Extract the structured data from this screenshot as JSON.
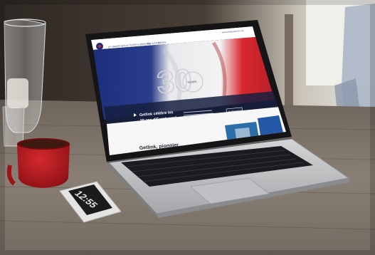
{
  "site": {
    "nav": {
      "items": [
        "LE GROUPE",
        "NOS ACTIVITÉS & SERVICES",
        "RSE & ENV",
        "MÉDIAS"
      ],
      "top_right": "INVESTISSEURS   FR / EN"
    },
    "hero": {
      "number": "30",
      "badge": "YEARS",
      "headline_line1": "Getlink célèbre les",
      "headline_line2": "30 ans d'Eurotunnel",
      "cta": "EN SAVOIR PLUS"
    },
    "section": {
      "title": "Getlink, pionnier"
    }
  },
  "phone": {
    "clock": "12:55"
  },
  "colors": {
    "flag_blue": "#1c2f7c",
    "flag_red": "#cf2430",
    "cup_red": "#b5161c",
    "laptop_silver": "#c9cacc"
  }
}
